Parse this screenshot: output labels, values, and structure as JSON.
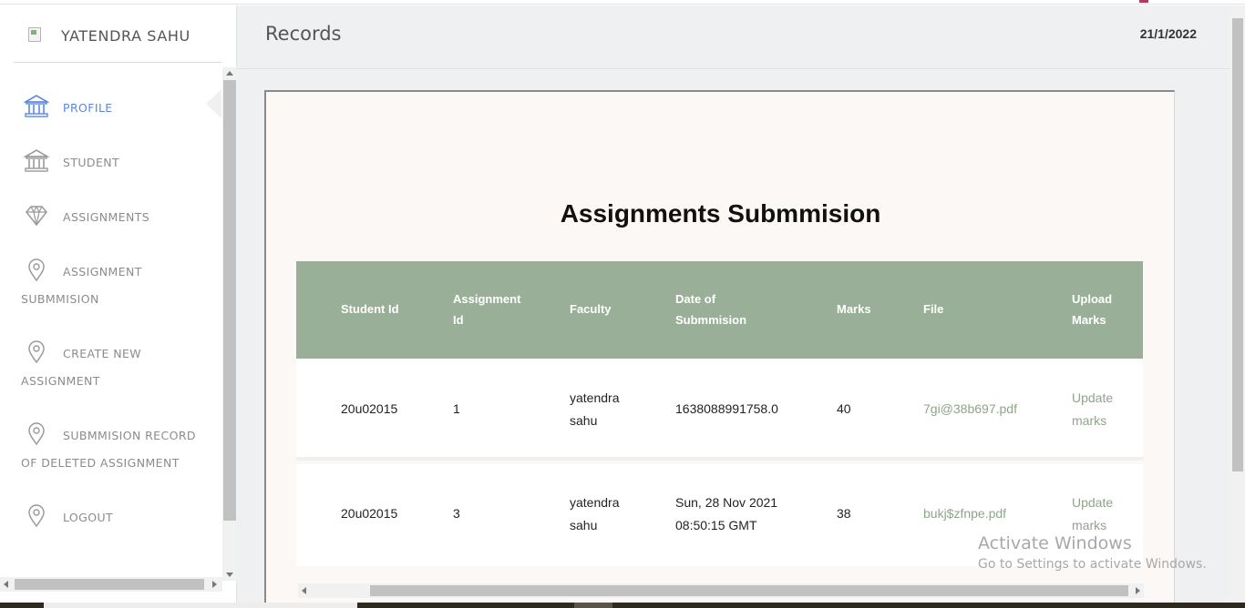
{
  "brand": {
    "name": "YATENDRA SAHU"
  },
  "sidebar": {
    "items": [
      {
        "line1": "PROFILE",
        "line2": "",
        "icon": "bank-icon",
        "active": true
      },
      {
        "line1": "STUDENT",
        "line2": "",
        "icon": "bank-icon",
        "active": false
      },
      {
        "line1": "ASSIGNMENTS",
        "line2": "",
        "icon": "diamond-icon",
        "active": false
      },
      {
        "line1": "ASSIGNMENT",
        "line2": "SUBMMISION",
        "icon": "location-pin-icon",
        "active": false
      },
      {
        "line1": "CREATE NEW",
        "line2": "ASSIGNMENT",
        "icon": "location-pin-icon",
        "active": false
      },
      {
        "line1": "SUBMMISION RECORD",
        "line2": "OF DELETED ASSIGNMENT",
        "icon": "location-pin-icon",
        "active": false
      },
      {
        "line1": "LOGOUT",
        "line2": "",
        "icon": "location-pin-icon",
        "active": false
      }
    ]
  },
  "header": {
    "title": "Records",
    "date": "21/1/2022"
  },
  "card": {
    "title": "Assignments Submmision"
  },
  "table": {
    "columns": [
      {
        "l1": "Student Id",
        "l2": ""
      },
      {
        "l1": "Assignment",
        "l2": "Id"
      },
      {
        "l1": "Faculty",
        "l2": ""
      },
      {
        "l1": "Date of",
        "l2": "Submmision"
      },
      {
        "l1": "Marks",
        "l2": ""
      },
      {
        "l1": "File",
        "l2": ""
      },
      {
        "l1": "Upload",
        "l2": "Marks"
      }
    ],
    "rows": [
      {
        "student_id": "20u02015",
        "assignment_id": "1",
        "faculty_l1": "yatendra",
        "faculty_l2": "sahu",
        "date_l1": "1638088991758.0",
        "date_l2": "",
        "marks": "40",
        "file": "7gi@38b697.pdf",
        "action_l1": "Update",
        "action_l2": "marks"
      },
      {
        "student_id": "20u02015",
        "assignment_id": "3",
        "faculty_l1": "yatendra",
        "faculty_l2": "sahu",
        "date_l1": "Sun, 28 Nov 2021",
        "date_l2": "08:50:15 GMT",
        "marks": "38",
        "file": "bukj$zfnpe.pdf",
        "action_l1": "Update",
        "action_l2": "marks"
      }
    ]
  },
  "watermark": {
    "line1": "Activate Windows",
    "line2": "Go to Settings to activate Windows."
  },
  "colors": {
    "accent": "#5b87e0",
    "table_header": "#9aaf98",
    "link": "#8ea58a",
    "main_bg": "#eef0f1"
  }
}
